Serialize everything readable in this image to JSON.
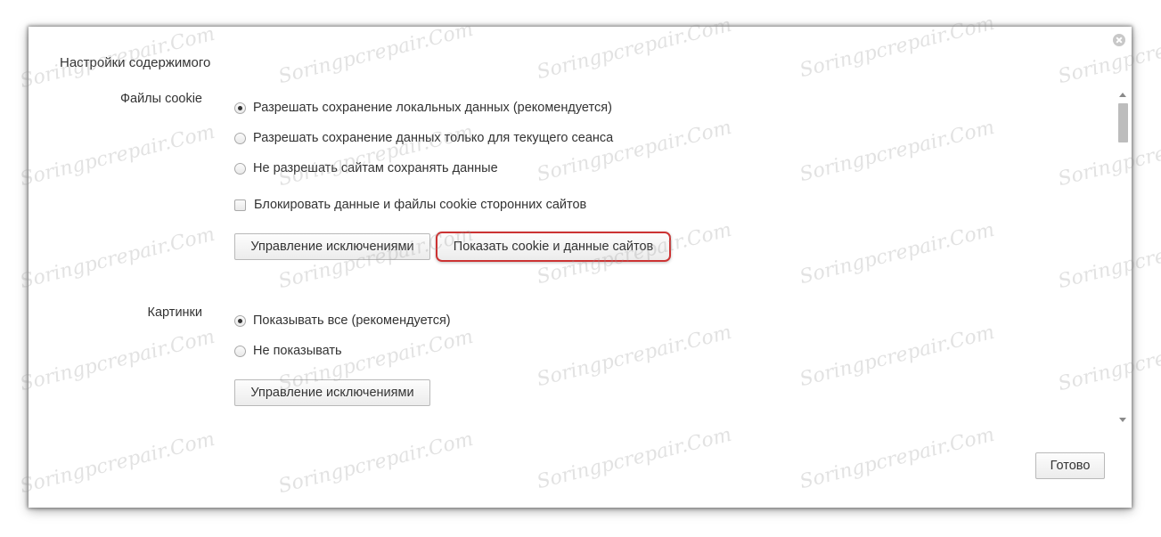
{
  "dialog": {
    "title": "Настройки содержимого",
    "done_label": "Готово"
  },
  "cookies": {
    "label": "Файлы cookie",
    "options": [
      {
        "label": "Разрешать сохранение локальных данных (рекомендуется)",
        "checked": true
      },
      {
        "label": "Разрешать сохранение данных только для текущего сеанса",
        "checked": false
      },
      {
        "label": "Не разрешать сайтам сохранять данные",
        "checked": false
      }
    ],
    "block_third_party": {
      "label": "Блокировать данные и файлы cookie сторонних сайтов",
      "checked": false
    },
    "manage_exceptions_label": "Управление исключениями",
    "show_cookies_label": "Показать cookie и данные сайтов"
  },
  "images": {
    "label": "Картинки",
    "options": [
      {
        "label": "Показывать все (рекомендуется)",
        "checked": true
      },
      {
        "label": "Не показывать",
        "checked": false
      }
    ],
    "manage_exceptions_label": "Управление исключениями"
  },
  "watermark": {
    "text": "Soringpcrepair.Com"
  },
  "colors": {
    "highlight_border": "#cc3333",
    "button_border": "#b9b9b9",
    "text": "#333333"
  }
}
